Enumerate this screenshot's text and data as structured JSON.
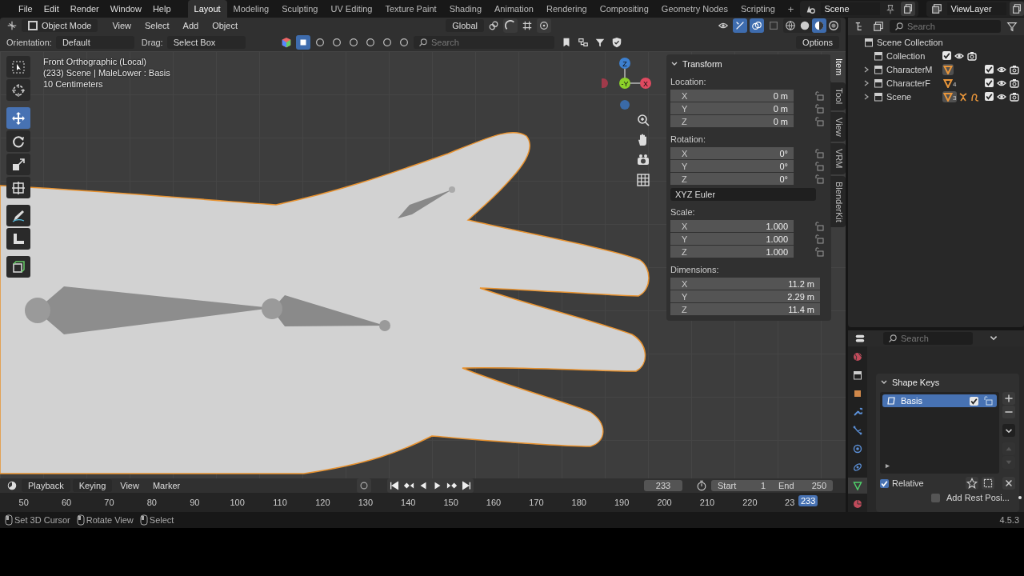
{
  "menu": [
    "File",
    "Edit",
    "Render",
    "Window",
    "Help"
  ],
  "workspaces": [
    {
      "label": "Layout",
      "selected": true
    },
    {
      "label": "Modeling",
      "selected": false
    },
    {
      "label": "Sculpting",
      "selected": false
    },
    {
      "label": "UV Editing",
      "selected": false
    },
    {
      "label": "Texture Paint",
      "selected": false
    },
    {
      "label": "Shading",
      "selected": false
    },
    {
      "label": "Animation",
      "selected": false
    },
    {
      "label": "Rendering",
      "selected": false
    },
    {
      "label": "Compositing",
      "selected": false
    },
    {
      "label": "Geometry Nodes",
      "selected": false
    },
    {
      "label": "Scripting",
      "selected": false
    }
  ],
  "add_workspace": "+",
  "scene": "Scene",
  "view_layer": "ViewLayer",
  "viewport_header": {
    "mode": "Object Mode",
    "menus": [
      "View",
      "Select",
      "Add",
      "Object"
    ],
    "transform_orientation": "Global"
  },
  "tool_settings": {
    "orientation_label": "Orientation:",
    "orientation": "Default",
    "drag_label": "Drag:",
    "drag": "Select Box",
    "search_placeholder": "Search",
    "options": "Options"
  },
  "viewport_info": [
    "Front Orthographic (Local)",
    "(233) Scene | MaleLower : Basis",
    "10 Centimeters"
  ],
  "toolbar": [
    {
      "kind": "select",
      "selected": false
    },
    {
      "kind": "cursor",
      "selected": false
    },
    {
      "kind": "move",
      "selected": true
    },
    {
      "kind": "rotate",
      "selected": false
    },
    {
      "kind": "scale",
      "selected": false
    },
    {
      "kind": "transform",
      "selected": false
    },
    {
      "kind": "annotate",
      "selected": false
    },
    {
      "kind": "measure",
      "selected": false
    },
    {
      "kind": "add_cube",
      "selected": false
    }
  ],
  "gizmo": {
    "z": "Z",
    "y": "-Y",
    "x": "X"
  },
  "sidebar": {
    "tabs": [
      {
        "label": "Item",
        "selected": true
      },
      {
        "label": "Tool",
        "selected": false
      },
      {
        "label": "View",
        "selected": false
      },
      {
        "label": "VRM",
        "selected": false
      },
      {
        "label": "BlenderKit",
        "selected": false
      }
    ],
    "panel_title": "Transform",
    "groups": [
      {
        "label": "Location:",
        "kind": "lockable",
        "fields": [
          {
            "axis": "X",
            "value": "0 m"
          },
          {
            "axis": "Y",
            "value": "0 m"
          },
          {
            "axis": "Z",
            "value": "0 m"
          }
        ]
      },
      {
        "label": "Rotation:",
        "kind": "lockable",
        "fields": [
          {
            "axis": "X",
            "value": "0°"
          },
          {
            "axis": "Y",
            "value": "0°"
          },
          {
            "axis": "Z",
            "value": "0°"
          }
        ],
        "mode": "XYZ Euler"
      },
      {
        "label": "Scale:",
        "kind": "lockable",
        "fields": [
          {
            "axis": "X",
            "value": "1.000"
          },
          {
            "axis": "Y",
            "value": "1.000"
          },
          {
            "axis": "Z",
            "value": "1.000"
          }
        ]
      },
      {
        "label": "Dimensions:",
        "kind": "plain",
        "fields": [
          {
            "axis": "X",
            "value": "11.2 m"
          },
          {
            "axis": "Y",
            "value": "2.29 m"
          },
          {
            "axis": "Z",
            "value": "11.4 m"
          }
        ]
      }
    ]
  },
  "outliner": {
    "search_placeholder": "Search",
    "root": "Scene Collection",
    "items": [
      {
        "name": "Collection",
        "checked": true,
        "visible": true,
        "renderable": true
      },
      {
        "name": "CharacterM",
        "expanded": false,
        "checked": true,
        "visible": true,
        "renderable": true,
        "badges": [
          {
            "kind": "mesh",
            "highlighted": true
          }
        ]
      },
      {
        "name": "CharacterF",
        "expanded": false,
        "checked": true,
        "visible": true,
        "renderable": true,
        "badges": [
          {
            "kind": "mesh",
            "highlighted": false,
            "count": "4"
          }
        ]
      },
      {
        "name": "Scene",
        "expanded": false,
        "checked": true,
        "visible": true,
        "renderable": true,
        "badges": [
          {
            "kind": "mesh",
            "highlighted": true,
            "count": "3"
          },
          {
            "kind": "armature",
            "highlighted": false
          },
          {
            "kind": "curve",
            "highlighted": false
          }
        ]
      }
    ]
  },
  "properties": {
    "search_placeholder": "Search",
    "tabs": [
      {
        "kind": "world",
        "selected": false
      },
      {
        "kind": "collection",
        "selected": false
      },
      {
        "kind": "object",
        "selected": false
      },
      {
        "kind": "modifier",
        "selected": false
      },
      {
        "kind": "particles",
        "selected": false
      },
      {
        "kind": "physics",
        "selected": false
      },
      {
        "kind": "constraints",
        "selected": false
      },
      {
        "kind": "data",
        "selected": true
      },
      {
        "kind": "material",
        "selected": false
      }
    ],
    "panel_title": "Shape Keys",
    "shape_keys": [
      {
        "name": "Basis",
        "selected": true,
        "checked": true
      }
    ],
    "relative": {
      "label": "Relative",
      "checked": true
    },
    "add_rest": {
      "label": "Add Rest Posi...",
      "checked": false
    }
  },
  "timeline": {
    "menus": [
      "Playback",
      "Keying",
      "View",
      "Marker"
    ],
    "current_frame": "233",
    "start_label": "Start",
    "start": "1",
    "end_label": "End",
    "end": "250",
    "ticks": [
      "50",
      "60",
      "70",
      "80",
      "90",
      "100",
      "110",
      "120",
      "130",
      "140",
      "150",
      "160",
      "170",
      "180",
      "190",
      "200",
      "210",
      "220",
      "23"
    ],
    "playhead": "233"
  },
  "status_bar": {
    "hints": [
      "Set 3D Cursor",
      "Rotate View",
      "Select"
    ],
    "version": "4.5.3"
  }
}
